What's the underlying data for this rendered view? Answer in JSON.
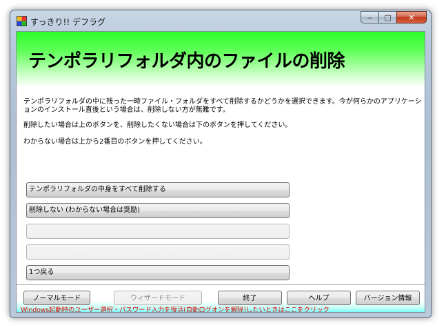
{
  "window": {
    "title": "すっきり!! デフラグ",
    "minimize_label": "‒",
    "maximize_label": "□",
    "close_label": "✕"
  },
  "banner": {
    "heading": "テンポラリフォルダ内のファイルの削除"
  },
  "description": {
    "line1": "テンポラリフォルダの中に残った一時ファイル・フォルダをすべて削除するかどうかを選択できます。今が何らかのアプリケーションのインストール直後という場合は、削除しない方が無難です。",
    "line2": "削除したい場合は上のボタンを、削除したくない場合は下のボタンを押してください。",
    "line3": "わからない場合は上から2番目のボタンを押してください。"
  },
  "options": [
    {
      "label": "テンポラリフォルダの中身をすべて削除する",
      "enabled": true
    },
    {
      "label": "削除しない (わからない場合は奨励)",
      "enabled": true
    },
    {
      "label": "",
      "enabled": false
    },
    {
      "label": "",
      "enabled": false
    },
    {
      "label": "1つ戻る",
      "enabled": true
    }
  ],
  "footer": {
    "normal_mode": "ノーマルモード",
    "wizard_mode": "ウィザードモード",
    "exit": "終了",
    "help": "ヘルプ",
    "version": "バージョン情報",
    "hint_link": "Windows起動時のユーザー選択・パスワード入力を復活(自動ログオンを解除)したいときはここをクリック"
  },
  "colors": {
    "banner_green": "#2dff2d",
    "footer_cyan": "#5fffff",
    "link_red": "#e00000"
  }
}
